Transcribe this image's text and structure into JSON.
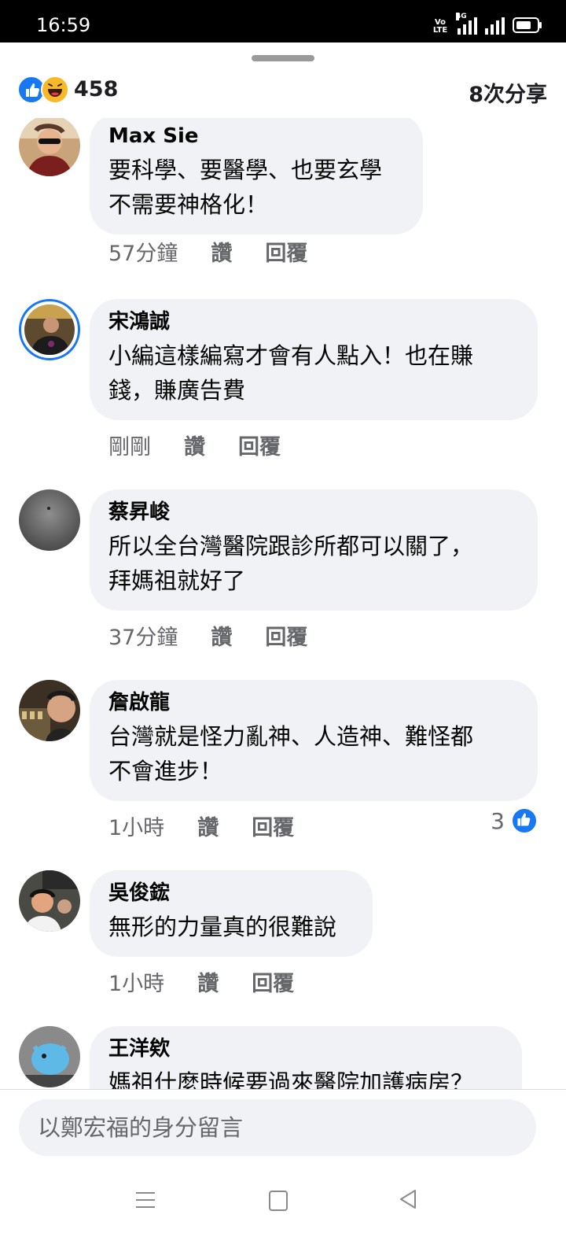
{
  "status_bar": {
    "time": "16:59",
    "volte_label": "VoLTE",
    "network_label": "4G"
  },
  "reactions": {
    "count": "458",
    "shares": "8次分享"
  },
  "comments": [
    {
      "name": "Max Sie",
      "lines": [
        "要科學、要醫學、也要玄學",
        "不需要神格化！"
      ],
      "time": "57分鐘",
      "like": "讚",
      "reply": "回覆"
    },
    {
      "name": "宋鴻誠",
      "lines": [
        "小編這樣編寫才會有人點入！也在賺",
        "錢，賺廣告費"
      ],
      "time": "剛剛",
      "like": "讚",
      "reply": "回覆"
    },
    {
      "name": "蔡昇峻",
      "lines": [
        "所以全台灣醫院跟診所都可以關了，",
        "拜媽祖就好了"
      ],
      "time": "37分鐘",
      "like": "讚",
      "reply": "回覆"
    },
    {
      "name": "詹啟龍",
      "lines": [
        "台灣就是怪力亂神、人造神、難怪都",
        "不會進步！"
      ],
      "time": "1小時",
      "like": "讚",
      "reply": "回覆",
      "reaction_count": "3"
    },
    {
      "name": "吳俊鋐",
      "lines": [
        "無形的力量真的很難說"
      ],
      "time": "1小時",
      "like": "讚",
      "reply": "回覆"
    },
    {
      "name": "王洋欸",
      "lines": [
        "媽祖什麼時候要過來醫院加護病房？"
      ]
    }
  ],
  "composer": {
    "placeholder": "以鄭宏福的身分留言"
  },
  "colors": {
    "accent": "#1877f2",
    "bubble": "#f0f2f5",
    "secondary_text": "#65676b"
  }
}
